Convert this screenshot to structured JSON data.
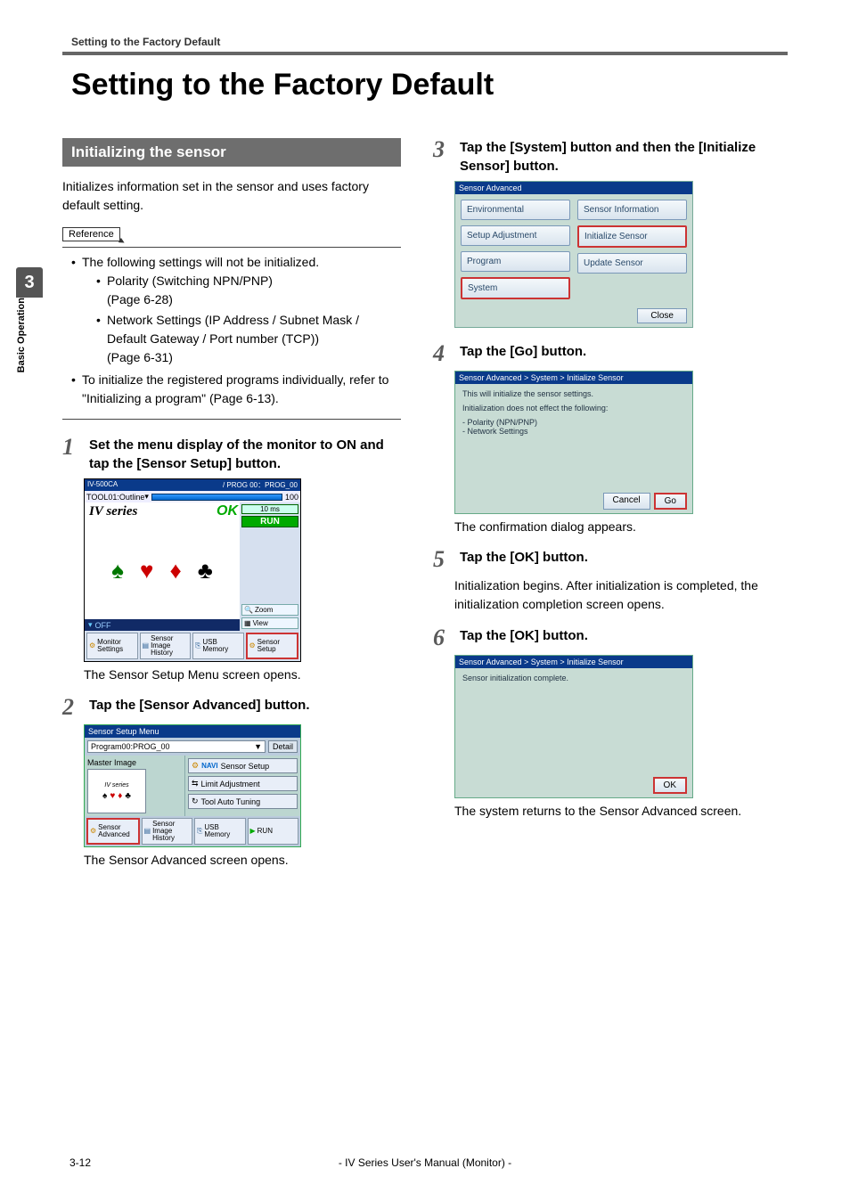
{
  "running_head": "Setting to the Factory Default",
  "title": "Setting to the Factory Default",
  "section_heading": "Initializing the sensor",
  "intro": "Initializes information set in the sensor and uses factory default setting.",
  "reference_label": "Reference",
  "ref": {
    "line1": "The following settings will not be initialized.",
    "sub1a": "Polarity (Switching NPN/PNP)",
    "sub1b": "(Page 6-28)",
    "sub2a": "Network Settings (IP Address / Subnet Mask / Default Gateway / Port number (TCP))",
    "sub2b": "(Page 6-31)",
    "line2": "To initialize the registered programs individually, refer to \"Initializing a program\" (Page 6-13)."
  },
  "steps": {
    "s1": {
      "num": "1",
      "text": "Set the menu display of the monitor to ON and tap the [Sensor Setup] button.",
      "caption": "The Sensor Setup Menu screen opens."
    },
    "s2": {
      "num": "2",
      "text": "Tap the [Sensor Advanced] button.",
      "caption": "The Sensor Advanced screen opens."
    },
    "s3": {
      "num": "3",
      "text": "Tap the [System] button and then the [Initialize Sensor] button."
    },
    "s4": {
      "num": "4",
      "text": "Tap the [Go] button.",
      "caption": "The confirmation dialog appears."
    },
    "s5": {
      "num": "5",
      "text": "Tap the [OK] button.",
      "body": "Initialization begins. After initialization is completed, the initialization completion screen opens."
    },
    "s6": {
      "num": "6",
      "text": "Tap the [OK] button.",
      "caption": "The system returns to the Sensor Advanced screen."
    }
  },
  "fig1": {
    "model": "IV-500CA",
    "prog": "PROG 00：PROG_00",
    "tool": "TOOL01:Outline",
    "ok": "OK",
    "score": "100",
    "ms": "10 ms",
    "run": "RUN",
    "ivseries": "IV series",
    "zoom": "Zoom",
    "view": "View",
    "off": "OFF",
    "tabs": {
      "monitor": "Monitor Settings",
      "history": "Sensor Image History",
      "usb": "USB Memory",
      "setup": "Sensor Setup"
    }
  },
  "fig2": {
    "title": "Sensor Setup Menu",
    "program": "Program00:PROG_00",
    "detail": "Detail",
    "master": "Master Image",
    "thumb_label": "IV series",
    "navi": "NAVI",
    "btn_setup": "Sensor Setup",
    "btn_limit": "Limit Adjustment",
    "btn_tuning": "Tool Auto Tuning",
    "tabs": {
      "adv": "Sensor Advanced",
      "history": "Sensor Image History",
      "usb": "USB Memory",
      "run": "RUN"
    }
  },
  "fig3": {
    "title": "Sensor Advanced",
    "left": {
      "env": "Environmental",
      "setup": "Setup Adjustment",
      "program": "Program",
      "system": "System"
    },
    "right": {
      "info": "Sensor Information",
      "init": "Initialize Sensor",
      "update": "Update Sensor"
    },
    "close": "Close"
  },
  "fig4": {
    "title": "Sensor Advanced > System > Initialize Sensor",
    "line1": "This will initialize the sensor settings.",
    "line2": "Initialization does not effect the following:",
    "line3": "- Polarity (NPN/PNP)",
    "line4": "- Network Settings",
    "cancel": "Cancel",
    "go": "Go"
  },
  "fig6": {
    "title": "Sensor Advanced > System > Initialize Sensor",
    "body": "Sensor initialization complete.",
    "ok": "OK"
  },
  "side": {
    "num": "3",
    "label": "Basic Operation"
  },
  "footer": {
    "page": "3-12",
    "center": "- IV Series User's Manual (Monitor) -"
  }
}
